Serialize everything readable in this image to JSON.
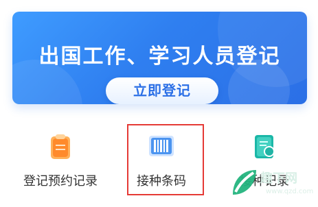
{
  "banner": {
    "title": "出国工作、学习人员登记",
    "button_label": "立即登记"
  },
  "shortcuts": [
    {
      "label": "登记预约记录",
      "icon": "clipboard-icon",
      "color": "#ff9a3c"
    },
    {
      "label": "接种条码",
      "icon": "barcode-icon",
      "color": "#4a90e2",
      "selected": true
    },
    {
      "label": "接种记录",
      "icon": "vaccination-record-icon",
      "color": "#22b8a6"
    }
  ],
  "highlight_color": "#e53935",
  "watermark": {
    "text": "趣下网",
    "sub_text": "www.qzd.com"
  }
}
